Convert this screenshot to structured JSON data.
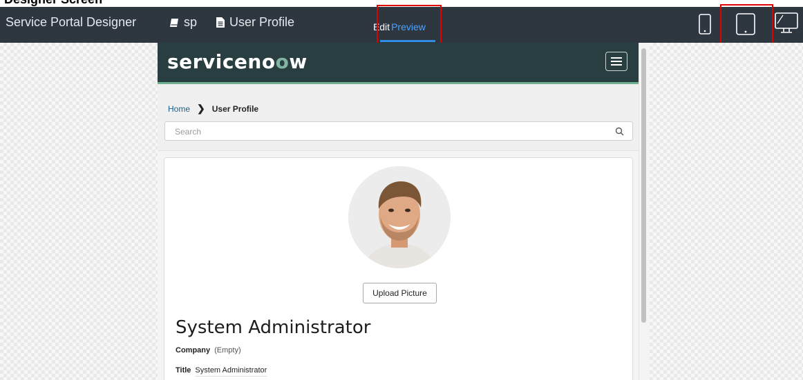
{
  "page_heading_cropped": "Designer Screen",
  "header": {
    "app_title": "Service Portal Designer",
    "portal_icon": "book-icon",
    "portal_name": "sp",
    "page_icon": "document-icon",
    "page_name": "User Profile",
    "tabs": [
      {
        "label": "Edit",
        "active": false
      },
      {
        "label": "Preview",
        "active": true
      }
    ],
    "devices": [
      {
        "name": "phone",
        "icon": "phone-icon",
        "active": false
      },
      {
        "name": "tablet",
        "icon": "tablet-icon",
        "active": true
      },
      {
        "name": "desktop",
        "icon": "desktop-icon",
        "active": false
      }
    ]
  },
  "portal": {
    "logo_text": "servicenow",
    "logo_main": "serviceno",
    "logo_o": "w",
    "menu_icon": "hamburger-icon",
    "breadcrumb": {
      "home": "Home",
      "separator": "❯",
      "current": "User Profile"
    },
    "search": {
      "placeholder": "Search",
      "icon": "search-icon"
    },
    "profile": {
      "upload_label": "Upload Picture",
      "name": "System Administrator",
      "fields": [
        {
          "label": "Company",
          "value": "(Empty)"
        },
        {
          "label": "Title",
          "value": "System Administrator"
        }
      ]
    }
  },
  "colors": {
    "designer_header": "#2e3640",
    "active_tab": "#4aa3ff",
    "highlight_box": "#e00000",
    "portal_nav": "#293e40",
    "portal_accent": "#6fae8f"
  }
}
